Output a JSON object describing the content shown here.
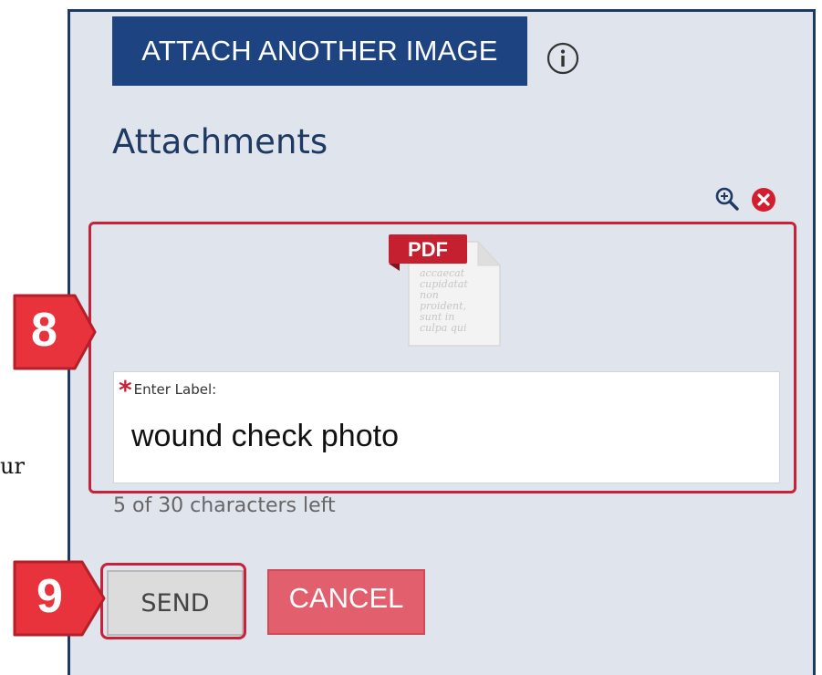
{
  "stray_text": "ur",
  "toolbar": {
    "attach_label": "ATTACH ANOTHER IMAGE",
    "info_icon": "info-circle-icon"
  },
  "attachments": {
    "heading": "Attachments",
    "zoom_icon": "zoom-in-icon",
    "remove_icon": "remove-circle-icon",
    "item": {
      "file_type": "PDF",
      "thumb_text": [
        "accaecat",
        "cupidatat",
        "non",
        "proident,",
        "sunt in",
        "culpa qui"
      ]
    }
  },
  "label_field": {
    "caption": "Enter Label:",
    "required_mark": "*",
    "value": "wound check photo",
    "chars_left_text": "5 of 30 characters left"
  },
  "actions": {
    "send_label": "SEND",
    "cancel_label": "CANCEL"
  },
  "callouts": {
    "step_a": "8",
    "step_b": "9"
  },
  "colors": {
    "primary": "#1d4480",
    "panel_bg": "#e0e4ec",
    "highlight": "#c8223a",
    "cancel_bg": "#e2606e",
    "callout": "#e8323c"
  }
}
